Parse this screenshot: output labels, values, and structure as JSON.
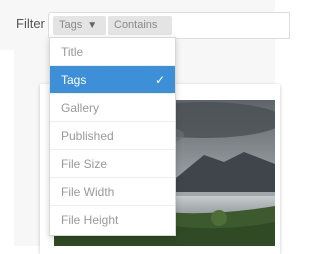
{
  "filter": {
    "label": "Filter",
    "pills": [
      {
        "label": "Tags",
        "icon": "caret-down-icon"
      },
      {
        "label": "Contains",
        "icon": "caret-down-icon"
      }
    ]
  },
  "dropdown": {
    "items": [
      {
        "label": "Title",
        "selected": false
      },
      {
        "label": "Tags",
        "selected": true,
        "check": "✓"
      },
      {
        "label": "Gallery",
        "selected": false
      },
      {
        "label": "Published",
        "selected": false
      },
      {
        "label": "File Size",
        "selected": false
      },
      {
        "label": "File Width",
        "selected": false
      },
      {
        "label": "File Height",
        "selected": false
      }
    ]
  },
  "colors": {
    "selected_bg": "#3d8fd8",
    "menu_text": "#999999",
    "pill_bg": "#e4e4e4"
  }
}
